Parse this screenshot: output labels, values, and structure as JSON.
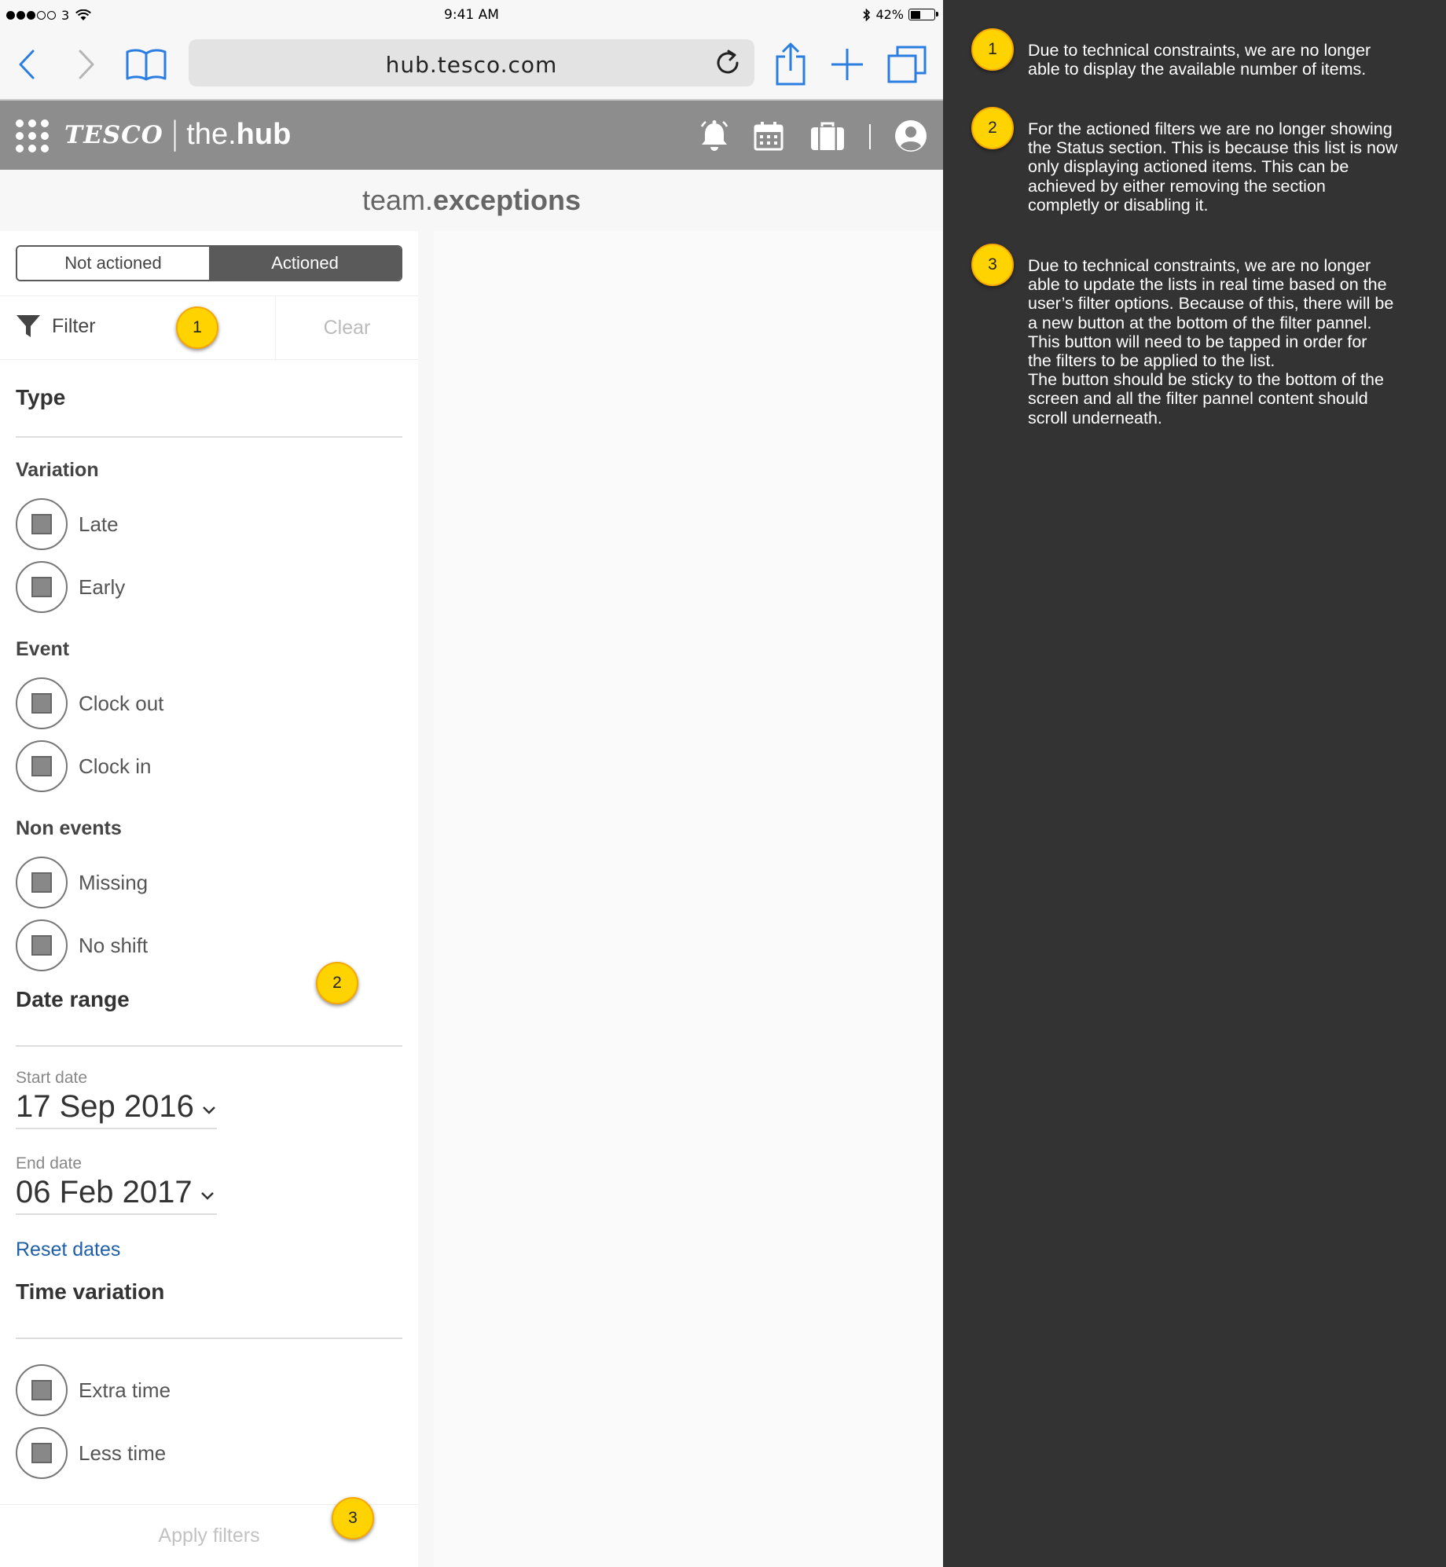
{
  "status_bar": {
    "carrier": "3",
    "time": "9:41 AM",
    "battery_text": "42%",
    "battery_level": 0.42
  },
  "browser": {
    "url": "hub.tesco.com"
  },
  "app_header": {
    "brand": "TESCO",
    "separator": "|",
    "product_prefix": "the.",
    "product_bold": "hub",
    "icons": [
      "notifications-bell-icon",
      "calendar-icon",
      "briefcase-icon",
      "account-icon"
    ]
  },
  "page_title": {
    "prefix": "team.",
    "bold": "exceptions"
  },
  "segmented": {
    "not_actioned": "Not actioned",
    "actioned": "Actioned",
    "selected": "Actioned"
  },
  "filter_bar": {
    "filter_label": "Filter",
    "clear_label": "Clear"
  },
  "type_section": {
    "title": "Type",
    "groups": [
      {
        "title": "Variation",
        "options": [
          "Late",
          "Early"
        ]
      },
      {
        "title": "Event",
        "options": [
          "Clock out",
          "Clock in"
        ]
      },
      {
        "title": "Non events",
        "options": [
          "Missing",
          "No shift"
        ]
      }
    ]
  },
  "date_section": {
    "title": "Date range",
    "start_label": "Start date",
    "start_value": "17 Sep 2016",
    "end_label": "End date",
    "end_value": "06 Feb 2017",
    "reset_label": "Reset dates"
  },
  "time_section": {
    "title": "Time variation",
    "options": [
      "Extra time",
      "Less time"
    ]
  },
  "apply_button": "Apply filters",
  "markers": [
    "1",
    "2",
    "3"
  ],
  "notes": [
    {
      "number": "1",
      "text": "Due to technical constraints, we are no longer\nable to display the available number of items."
    },
    {
      "number": "2",
      "text": "For the actioned filters we are no longer showing\nthe Status section. This is because this list is now\nonly displaying actioned items. This can be\nachieved by either removing the section\ncompletly or disabling it."
    },
    {
      "number": "3",
      "text": "Due to technical constraints, we are no longer\nable to update the lists in real time based on the\nuser’s filter options. Because of this, there will be\na new button at the bottom of the filter pannel.\nThis button will need to be tapped in order for\nthe filters to be applied to the list.\nThe button should be sticky to the bottom of the\nscreen and all the filter pannel content should\nscroll underneath."
    }
  ],
  "colors": {
    "header_bg": "#8d8d8d",
    "ios_blue": "#2a7de1",
    "link_blue": "#1f5fa8",
    "marker_yellow": "#ffd300",
    "notes_bg": "#333333"
  }
}
